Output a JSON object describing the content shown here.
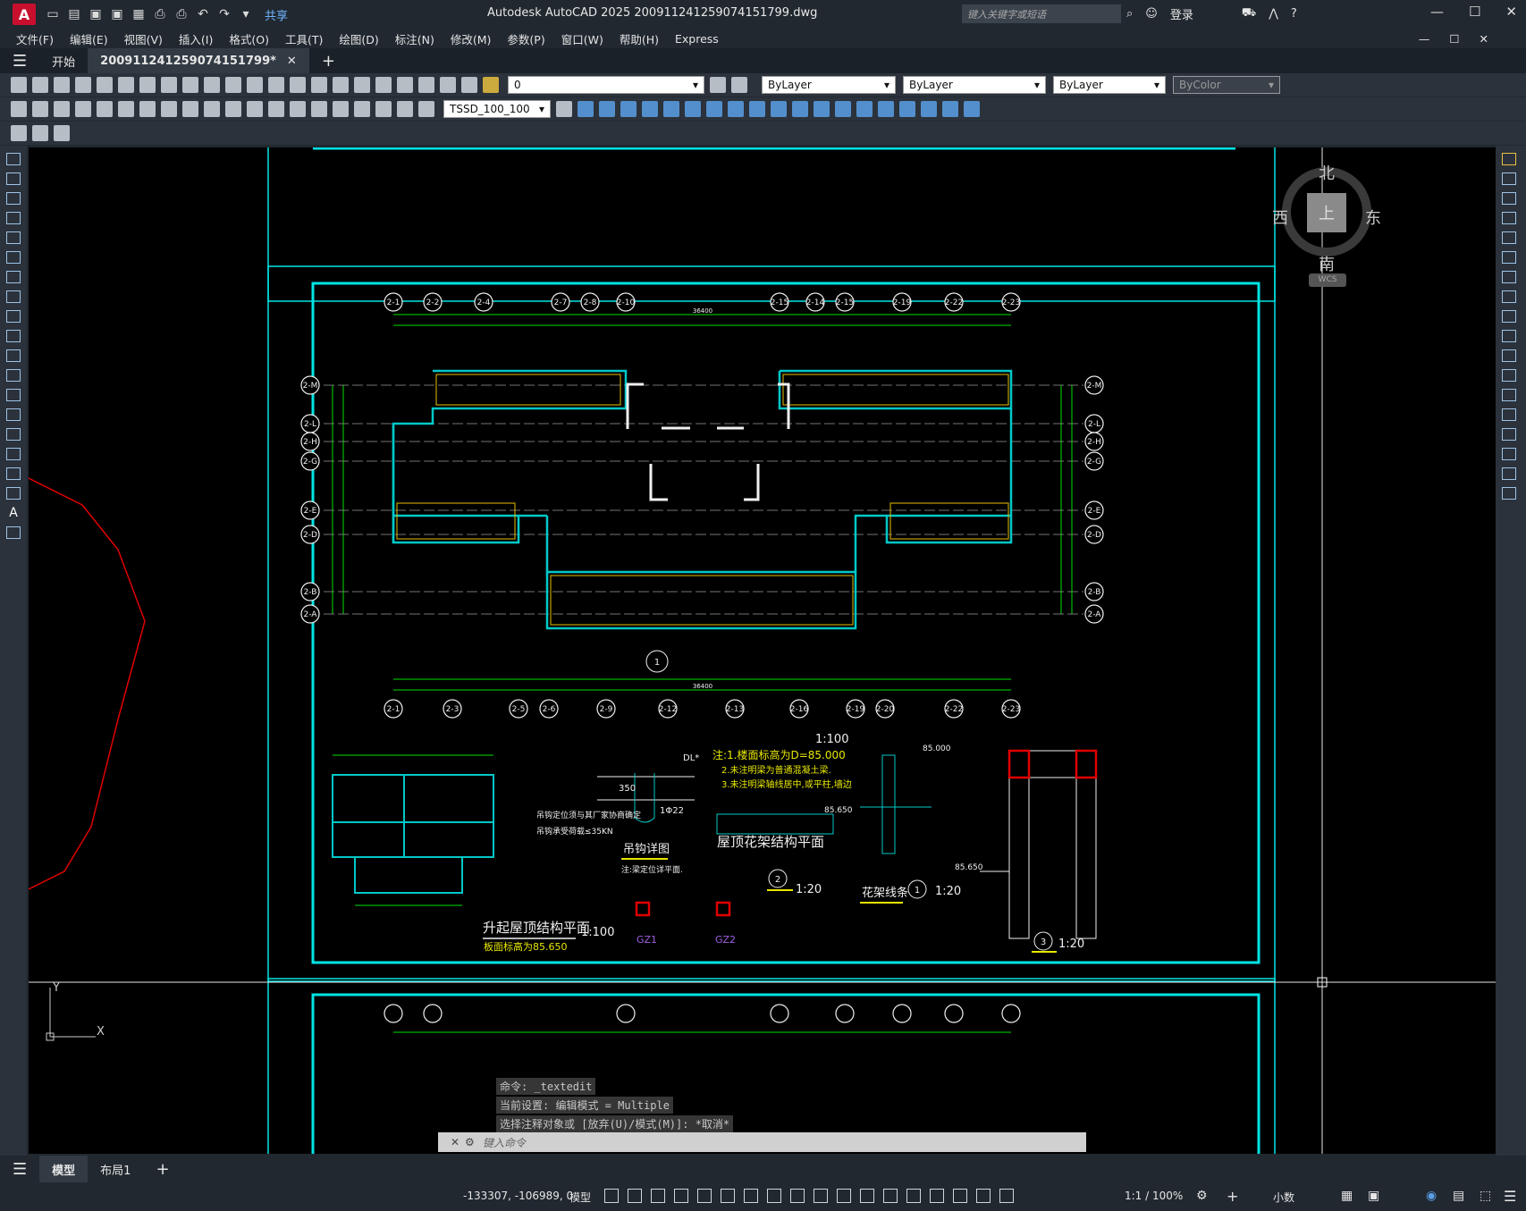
{
  "app": {
    "logo_letter": "A",
    "title": "Autodesk AutoCAD 2025    20091124125907415179​9.dwg",
    "share_label": "共享",
    "search_placeholder": "键入关键字或短语",
    "login_label": "登录"
  },
  "menu": [
    "文件(F)",
    "编辑(E)",
    "视图(V)",
    "插入(I)",
    "格式(O)",
    "工具(T)",
    "绘图(D)",
    "标注(N)",
    "修改(M)",
    "参数(P)",
    "窗口(W)",
    "帮助(H)",
    "Express"
  ],
  "tabs": {
    "start": "开始",
    "doc": "20091124125907415179​9*"
  },
  "toolbar": {
    "layer_value": "0",
    "style_value": "TSSD_100_100",
    "color_value": "ByLayer",
    "linetype_value": "ByLayer",
    "lineweight_value": "ByLayer",
    "plotstyle_value": "ByColor"
  },
  "viewcube": {
    "north": "北",
    "south": "南",
    "east": "东",
    "west": "西",
    "top": "上",
    "wcs": "WCS"
  },
  "drawing": {
    "grid_top": [
      "2-1",
      "2-2",
      "2-4",
      "2-7",
      "2-8",
      "2-10",
      "2-15",
      "2-14",
      "2-15",
      "2-19",
      "2-22",
      "2-23"
    ],
    "grid_bottom": [
      "2-1",
      "2-3",
      "2-5",
      "2-6",
      "2-9",
      "2-12",
      "2-13",
      "2-16",
      "2-19",
      "2-20",
      "2-22",
      "2-23"
    ],
    "grid_left": [
      "2-M",
      "2-L",
      "2-H",
      "2-G",
      "2-E",
      "2-D",
      "2-B",
      "2-A"
    ],
    "grid_right": [
      "2-M",
      "2-L",
      "2-H",
      "2-G",
      "2-E",
      "2-D",
      "2-B",
      "2-A"
    ],
    "total_dim": "36400",
    "note1": "注:1.楼面标高为D=85.000",
    "note2": "2.未注明梁为普通混凝土梁.",
    "note3": "3.未注明梁轴线居中,或平柱,墙边",
    "scale_100": "1:100",
    "detail_hook": "吊钩详图",
    "hook_note1": "吊钩定位须与其厂家协商确定",
    "hook_note2": "吊钩承受荷载≤35KN",
    "hook_note3": "注:梁定位详平面.",
    "roof_frame": "屋顶花架结构平面",
    "frame_strip": "花架线条",
    "scale_20": "1:20",
    "raised_roof": "升起屋顶结构平面",
    "raised_level": "板面标高为85.650",
    "level_85000": "85.000",
    "level_85650": "85.650",
    "gz1": "GZ1",
    "gz2": "GZ2",
    "detail_num_1": "1",
    "detail_num_2": "2",
    "detail_num_3": "3",
    "dl_mark": "DL*",
    "dim_350": "350",
    "dim_a22": "1Φ22"
  },
  "command": {
    "line1": "命令:  _textedit",
    "line2": "当前设置: 编辑模式 = Multiple",
    "line3": "选择注释对象或 [放弃(U)/模式(M)]: *取消*",
    "input_placeholder": "键入命令"
  },
  "layouts": {
    "model": "模型",
    "layout1": "布局1"
  },
  "status": {
    "coords": "-133307, -106989, 0",
    "model": "模型",
    "scale": "1:1 / 100%",
    "decimal": "小数"
  },
  "colors": {
    "frame": "#00e5e5",
    "grid": "#00e000",
    "wall": "#00c8c8",
    "note": "#e8e800",
    "red": "#e00000"
  }
}
